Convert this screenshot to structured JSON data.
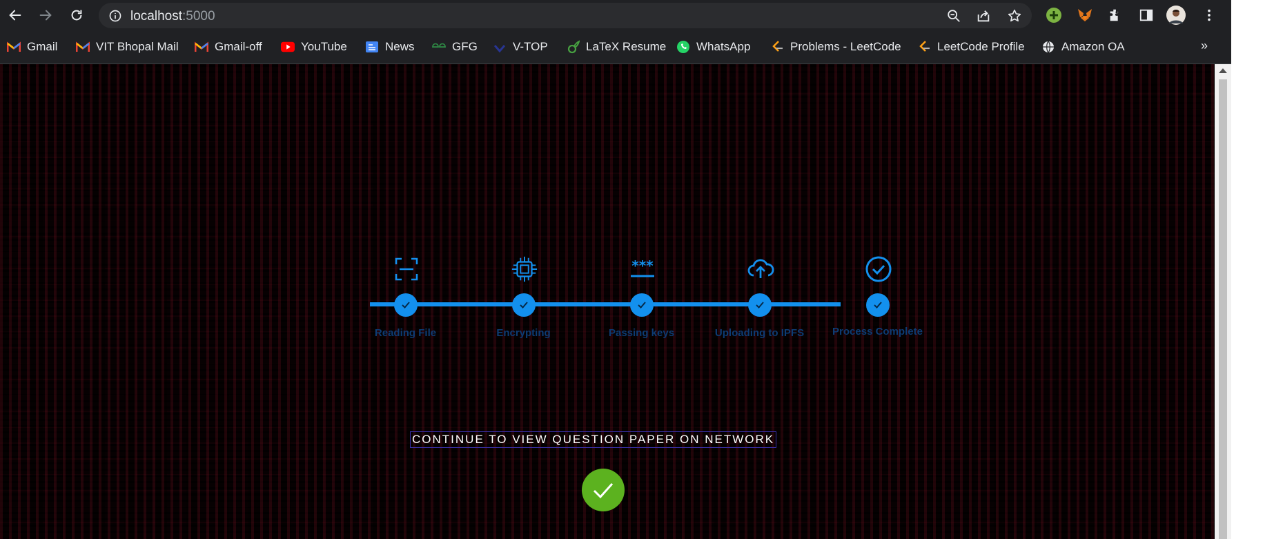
{
  "browser": {
    "url_host": "localhost",
    "url_port": ":5000",
    "icons": {
      "back": "arrow-left-icon",
      "forward": "arrow-right-icon",
      "reload": "reload-icon",
      "site_info": "info-icon",
      "zoom": "zoom-icon",
      "share": "share-icon",
      "bookmark": "star-icon",
      "extensions": [
        "plus-extension-icon",
        "metamask-fox-icon",
        "puzzle-icon",
        "side-panel-icon",
        "profile-avatar",
        "kebab-menu-icon"
      ]
    },
    "bookmarks": [
      {
        "label": "Gmail",
        "icon": "gmail-icon",
        "color": "#ea4335"
      },
      {
        "label": "VIT Bhopal Mail",
        "icon": "gmail-icon",
        "color": "#ea4335"
      },
      {
        "label": "Gmail-off",
        "icon": "gmail-icon",
        "color": "#ea4335"
      },
      {
        "label": "YouTube",
        "icon": "youtube-icon",
        "color": "#ff0000"
      },
      {
        "label": "News",
        "icon": "google-news-icon",
        "color": "#4285f4"
      },
      {
        "label": "GFG",
        "icon": "gfg-icon",
        "color": "#2f8d46"
      },
      {
        "label": "V-TOP",
        "icon": "vtop-icon",
        "color": "#1a237e"
      },
      {
        "label": "LaTeX Resume",
        "icon": "overleaf-icon",
        "color": "#47a141"
      },
      {
        "label": "WhatsApp",
        "icon": "whatsapp-icon",
        "color": "#25d366"
      },
      {
        "label": "Problems - LeetCode",
        "icon": "leetcode-icon",
        "color": "#ffa116"
      },
      {
        "label": "LeetCode Profile",
        "icon": "leetcode-icon",
        "color": "#ffa116"
      },
      {
        "label": "Amazon OA",
        "icon": "globe-icon",
        "color": "#e8eaed"
      }
    ],
    "more_bookmarks": "»"
  },
  "page": {
    "accent_color": "#1390ee",
    "steps": [
      {
        "label": "Reading File",
        "icon": "scan-icon",
        "status": "complete"
      },
      {
        "label": "Encrypting",
        "icon": "chip-icon",
        "status": "complete"
      },
      {
        "label": "Passing keys",
        "icon": "password-icon",
        "status": "complete"
      },
      {
        "label": "Uploading to IPFS",
        "icon": "cloud-upload-icon",
        "status": "complete"
      },
      {
        "label": "Process Complete",
        "icon": "check-circle-icon",
        "status": "complete"
      }
    ],
    "continue_label": "CONTINUE TO VIEW QUESTION PAPER ON NETWORK",
    "success_icon": "check-icon",
    "success_color": "#5cb21f"
  }
}
